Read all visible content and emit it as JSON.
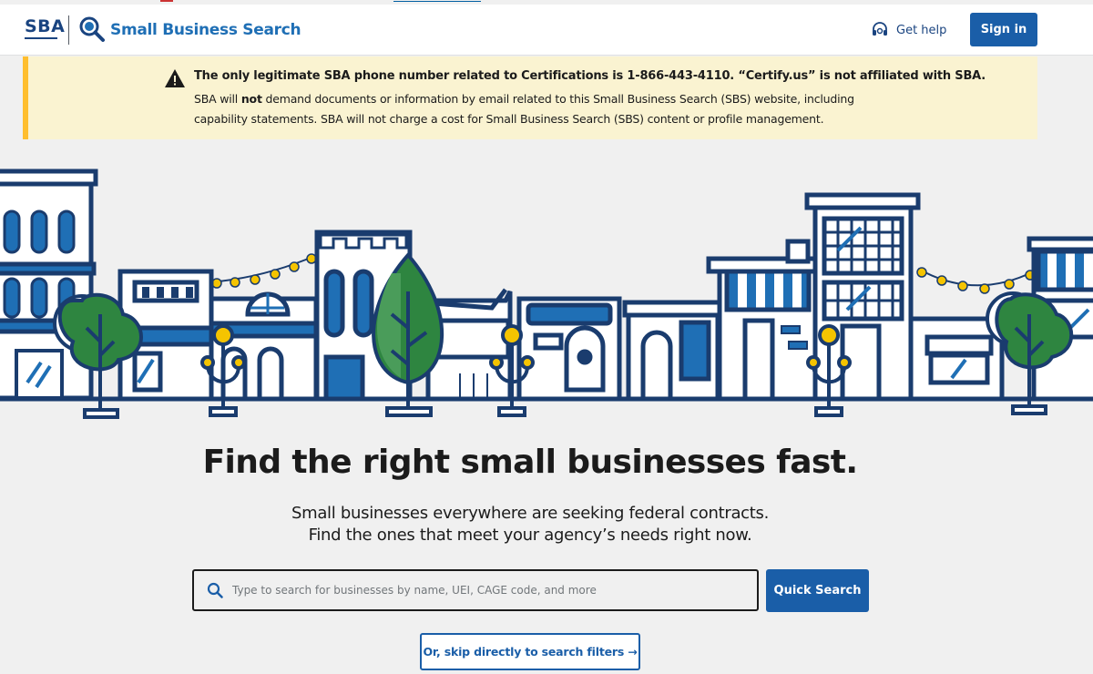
{
  "header": {
    "logo_text": "SBA",
    "site_title": "Small Business Search",
    "help_label": "Get help",
    "signin_label": "Sign in"
  },
  "alert": {
    "heading": "The only legitimate SBA phone number related to Certifications is 1-866-443-4110. “Certify.us” is not affiliated with SBA.",
    "body_pre": "SBA will ",
    "body_strong": "not",
    "body_post": " demand documents or information by email related to this Small Business Search (SBS) website, including capability statements. SBA will not charge a cost for Small Business Search (SBS) content or profile management."
  },
  "hero": {
    "title_pre": "Find the right small businesses ",
    "title_strong": "fast",
    "title_post": ".",
    "subtitle_line1": "Small businesses everywhere are seeking federal contracts.",
    "subtitle_line2": "Find the ones that meet your agency’s needs right now."
  },
  "search": {
    "placeholder": "Type to search for businesses by name, UEI, CAGE code, and more",
    "value": "",
    "button_label": "Quick Search",
    "skip_label": "Or, skip directly to search filters →"
  },
  "icons": {
    "logo_search": "magnifying-glass-icon",
    "help": "headset-icon",
    "alert": "warning-icon",
    "search": "search-icon"
  },
  "colors": {
    "primary": "#1a5ea8",
    "navy": "#1a4480",
    "alert_bg": "#faf3d1",
    "alert_border": "#ffbe2e",
    "tree_green": "#2e8540",
    "light_yellow": "#ffc107"
  }
}
